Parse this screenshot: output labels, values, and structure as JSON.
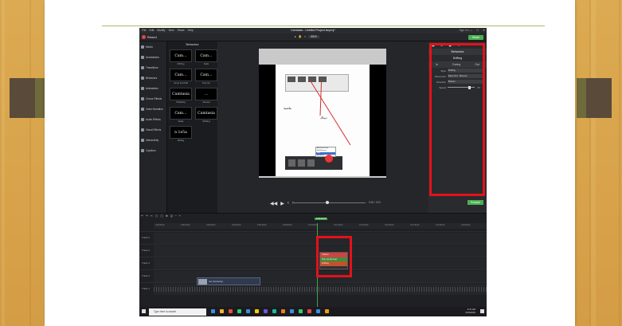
{
  "window": {
    "menu": [
      "File",
      "Edit",
      "Modify",
      "View",
      "Share",
      "Help"
    ],
    "title": "Camtasia - Untitled Project.tscproj*",
    "signin": "Sign In ▾",
    "controls": [
      "—",
      "☐",
      "✕"
    ]
  },
  "toolbar": {
    "record_label": "Record",
    "zoom": "85%",
    "share_label": "Share"
  },
  "tools": [
    "Media",
    "Annotations",
    "Transitions",
    "Behaviors",
    "Animations",
    "Cursor Effects",
    "Voice Narration",
    "Audio Effects",
    "Visual Effects",
    "Interactivity",
    "Captions"
  ],
  "assets": {
    "heading": "Behaviors",
    "items": [
      {
        "thumb": "Cam…",
        "label": "Drifting"
      },
      {
        "thumb": "Cam…",
        "label": "Fade"
      },
      {
        "thumb": "Cam…",
        "label": "Jump and Fall"
      },
      {
        "thumb": "Cam…",
        "label": "Pop Up"
      },
      {
        "thumb": "Camtasia",
        "label": "Pulsating"
      },
      {
        "thumb": "…",
        "label": "Reveal"
      },
      {
        "thumb": "Cam…",
        "label": "Scale"
      },
      {
        "thumb": "Camtasia",
        "label": "Shifting"
      },
      {
        "thumb": "n 1e5a",
        "label": "Sliding"
      }
    ]
  },
  "canvas": {
    "timecode": "0:00 / 0:01",
    "mini_labels": [
      "ماشية",
      "ديباك"
    ],
    "mini_menu": [
      "Add Interactivity",
      "Add Behavior",
      "Split",
      "Add Asset"
    ]
  },
  "properties": {
    "icons": [
      "▣",
      "⊕",
      "◼",
      "✎"
    ],
    "title": "Behaviors",
    "subtitle": "Drifting",
    "tabs": [
      "In",
      "During",
      "Out"
    ],
    "rows": [
      {
        "key": "Style",
        "value": "Drifting"
      },
      {
        "key": "Movement",
        "value": "Ease Out · Bounce"
      },
      {
        "key": "Direction",
        "value": "Bottom"
      },
      {
        "key": "Speed",
        "value": "0.5"
      }
    ],
    "produce_label": "Produce"
  },
  "timeline": {
    "tools": [
      "↶",
      "↷",
      "✂",
      "▢",
      "▢",
      "⊕",
      "Q",
      "−",
      "+"
    ],
    "playhead": "0:00:00;00",
    "ticks": [
      "0:00:00;00",
      "0:00:10;00",
      "0:00:20;00",
      "0:00:30;00",
      "0:00:40;00",
      "0:00:50;00",
      "0:01:00;00",
      "0:01:10;00",
      "0:01:20;00",
      "0:01:30;00",
      "0:01:40;00",
      "0:01:50;00",
      "0:02:00;00"
    ],
    "tracks": [
      "Track 5",
      "Track 4",
      "Track 3",
      "Track 2",
      "Track 1"
    ],
    "clip_menu": [
      "Callout",
      "Pop Up Reveal",
      "Drifting"
    ],
    "media_clip": "rec (Camera)"
  },
  "taskbar": {
    "search_placeholder": "Type here to search",
    "time": "9:47 AM",
    "date": "6/19/2019",
    "icon_colors": [
      "#3b8ee0",
      "#f2b233",
      "#e74c3c",
      "#2ecc71",
      "#3b8ee0",
      "#ffcc00",
      "#6a5acd",
      "#1abc9c",
      "#e67e22",
      "#3b8ee0",
      "#2ecc71",
      "#e74c3c",
      "#3b8ee0",
      "#f39c12"
    ]
  }
}
